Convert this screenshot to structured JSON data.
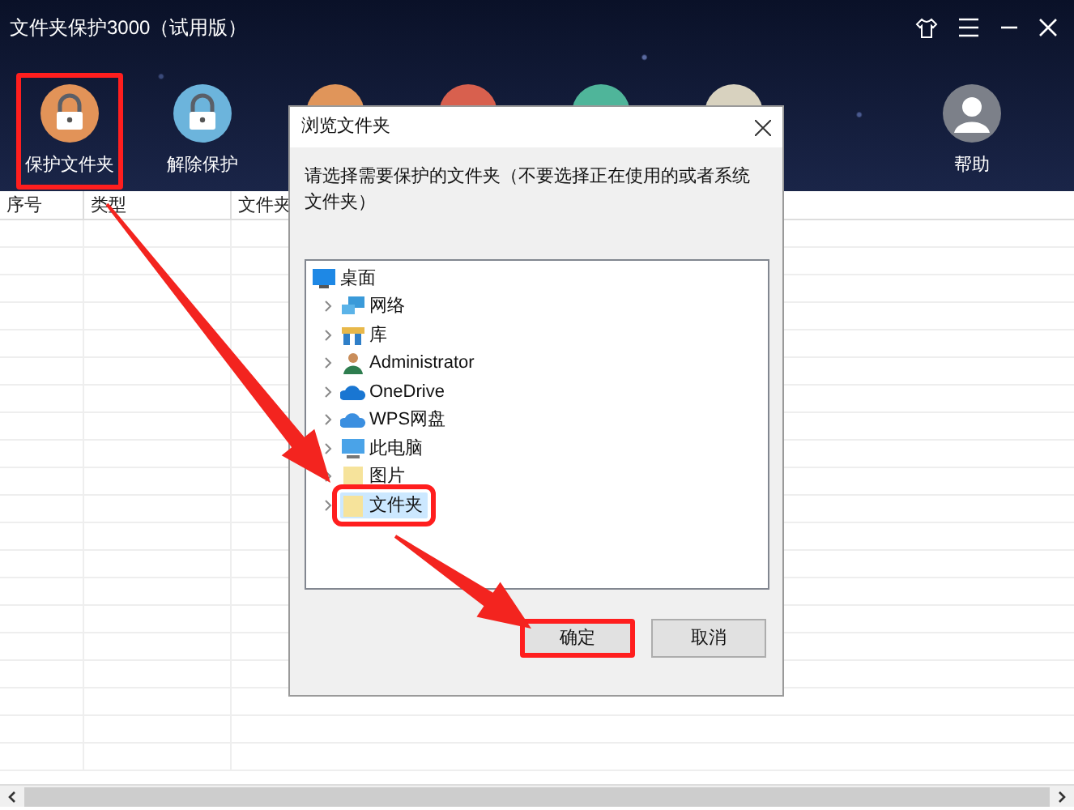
{
  "window": {
    "title": "文件夹保护3000（试用版）"
  },
  "toolbar": [
    {
      "label": "保护文件夹",
      "kind": "lock-orange",
      "selected": true
    },
    {
      "label": "解除保护",
      "kind": "lock-blue",
      "selected": false
    },
    {
      "kind": "hidden-orange"
    },
    {
      "kind": "hidden-red"
    },
    {
      "kind": "hidden-teal"
    },
    {
      "kind": "hidden-beige"
    },
    {
      "label": "帮助",
      "kind": "user",
      "selected": false
    }
  ],
  "table": {
    "columns": [
      "序号",
      "类型",
      "文件夹"
    ]
  },
  "dialog": {
    "title": "浏览文件夹",
    "prompt": "请选择需要保护的文件夹（不要选择正在使用的或者系统文件夹）",
    "tree": [
      {
        "label": "桌面",
        "kind": "desktop",
        "selected": false,
        "children": [
          {
            "label": "网络",
            "kind": "network",
            "expanded": false,
            "selected": false
          },
          {
            "label": "库",
            "kind": "library",
            "expanded": false,
            "selected": false
          },
          {
            "label": "Administrator",
            "kind": "user",
            "expanded": false,
            "selected": false
          },
          {
            "label": "OneDrive",
            "kind": "cloud",
            "expanded": false,
            "selected": false
          },
          {
            "label": "WPS网盘",
            "kind": "cloud-wps",
            "expanded": false,
            "selected": false
          },
          {
            "label": "此电脑",
            "kind": "computer",
            "expanded": false,
            "selected": false
          },
          {
            "label": "图片",
            "kind": "folder",
            "expanded": false,
            "selected": false
          },
          {
            "label": "文件夹",
            "kind": "folder",
            "expanded": false,
            "selected": true
          }
        ]
      }
    ],
    "buttons": [
      {
        "label": "确定",
        "selected": true
      },
      {
        "label": "取消",
        "selected": false
      }
    ]
  }
}
